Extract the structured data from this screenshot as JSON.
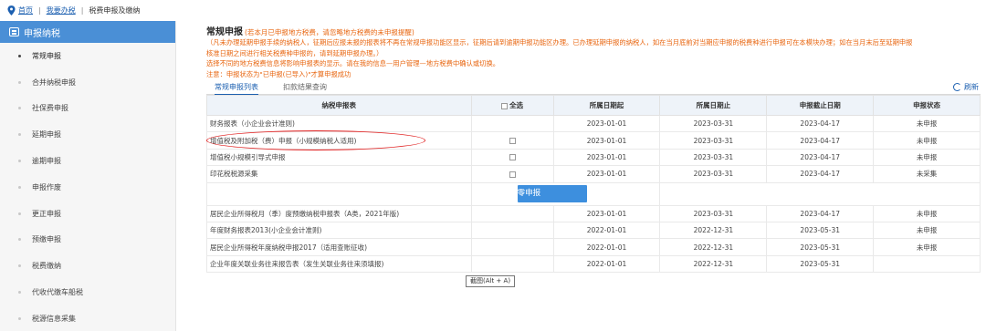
{
  "breadcrumb": {
    "home": "首页",
    "mine": "我要办税",
    "current": "税费申报及缴纳"
  },
  "sidebar": {
    "header": "申报纳税",
    "items": [
      {
        "label": "常规申报"
      },
      {
        "label": "合并纳税申报"
      },
      {
        "label": "社保费申报"
      },
      {
        "label": "延期申报"
      },
      {
        "label": "逾期申报"
      },
      {
        "label": "申报作废"
      },
      {
        "label": "更正申报"
      },
      {
        "label": "预缴申报"
      },
      {
        "label": "税费缴纳"
      },
      {
        "label": "代收代缴车船税"
      },
      {
        "label": "税源信息采集"
      }
    ]
  },
  "header": {
    "title": "常规申报",
    "warning": "(若本月已申报地方税费，请忽略地方税费的未申报提醒)",
    "notice1": "（凡未办理延期申报手续的纳税人，征期后应报未报的报表将不再在常规申报功能区显示，征期后请到逾期申报功能区办理。已办理延期申报的纳税人，如在当月底前对当期应申报的税费种进行申报可在本模块办理；如在当月末后至延期申报",
    "notice2": "核准日期之间进行相关税费种申报的，请到延期申报办理。）",
    "notice3": "选择不同的地方税费信息将影响申报表的显示。请在我的信息—用户管理—地方税费中确认或切换。",
    "notice4": "注意：申报状态为\"已申报(已导入)\"才算申报成功"
  },
  "tabs": {
    "regular": "常规申报列表",
    "deduction": "扣款结果查询",
    "refresh": "刷新"
  },
  "table": {
    "headers": {
      "name": "纳税申报表",
      "select_all": "全选",
      "start": "所属日期起",
      "end": "所属日期止",
      "deadline": "申报截止日期",
      "status": "申报状态"
    },
    "rows_top": [
      {
        "name": "财务报表（小企业会计准则)",
        "start": "2023-01-01",
        "end": "2023-03-31",
        "deadline": "2023-04-17",
        "status": "未申报"
      },
      {
        "name": "增值税及附加税（费）申报（小规模纳税人适用)",
        "start": "2023-01-01",
        "end": "2023-03-31",
        "deadline": "2023-04-17",
        "status": "未申报"
      },
      {
        "name": "增值税小规模引导式申报",
        "start": "2023-01-01",
        "end": "2023-03-31",
        "deadline": "2023-04-17",
        "status": "未申报"
      },
      {
        "name": "印花税税源采集",
        "start": "2023-01-01",
        "end": "2023-03-31",
        "deadline": "2023-04-17",
        "status": "未采集"
      }
    ],
    "zero_button": "零申报",
    "rows_bottom": [
      {
        "name": "居民企业所得税月（季）度预缴纳税申报表（A类，2021年版)",
        "start": "2023-01-01",
        "end": "2023-03-31",
        "deadline": "2023-04-17",
        "status": "未申报"
      },
      {
        "name": "年度财务报表2013(小企业会计准则)",
        "start": "2022-01-01",
        "end": "2022-12-31",
        "deadline": "2023-05-31",
        "status": "未申报"
      },
      {
        "name": "居民企业所得税年度纳税申报2017（适用查账征收)",
        "start": "2022-01-01",
        "end": "2022-12-31",
        "deadline": "2023-05-31",
        "status": "未申报"
      },
      {
        "name": "企业年度关联业务往来报告表（发生关联业务往来须填报)",
        "start": "2022-01-01",
        "end": "2022-12-31",
        "deadline": "2023-05-31",
        "status": ""
      }
    ]
  },
  "tooltip": "截图(Alt + A)"
}
